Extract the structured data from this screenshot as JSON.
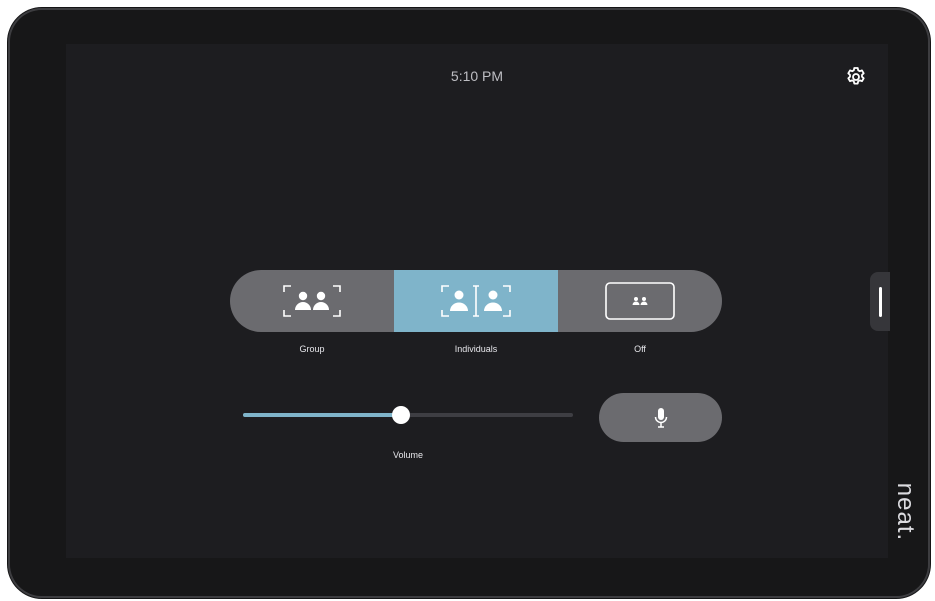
{
  "status_bar": {
    "time": "5:10 PM"
  },
  "header": {
    "settings_icon": "gear-icon"
  },
  "framing_modes": {
    "selected": "Individuals",
    "items": [
      {
        "label": "Group",
        "icon": "group-frame-icon"
      },
      {
        "label": "Individuals",
        "icon": "individuals-frame-icon"
      },
      {
        "label": "Off",
        "icon": "frame-off-icon"
      }
    ]
  },
  "volume": {
    "label": "Volume",
    "level": 0.48
  },
  "microphone": {
    "icon": "microphone-icon"
  },
  "side_panel": {
    "handle": "drawer-handle"
  },
  "brand": {
    "logo_text": "neat."
  },
  "colors": {
    "accent": "#7fb4ca",
    "segment_background": "#6b6b6f",
    "screen_background": "#1d1d20",
    "bezel": "#171718"
  }
}
